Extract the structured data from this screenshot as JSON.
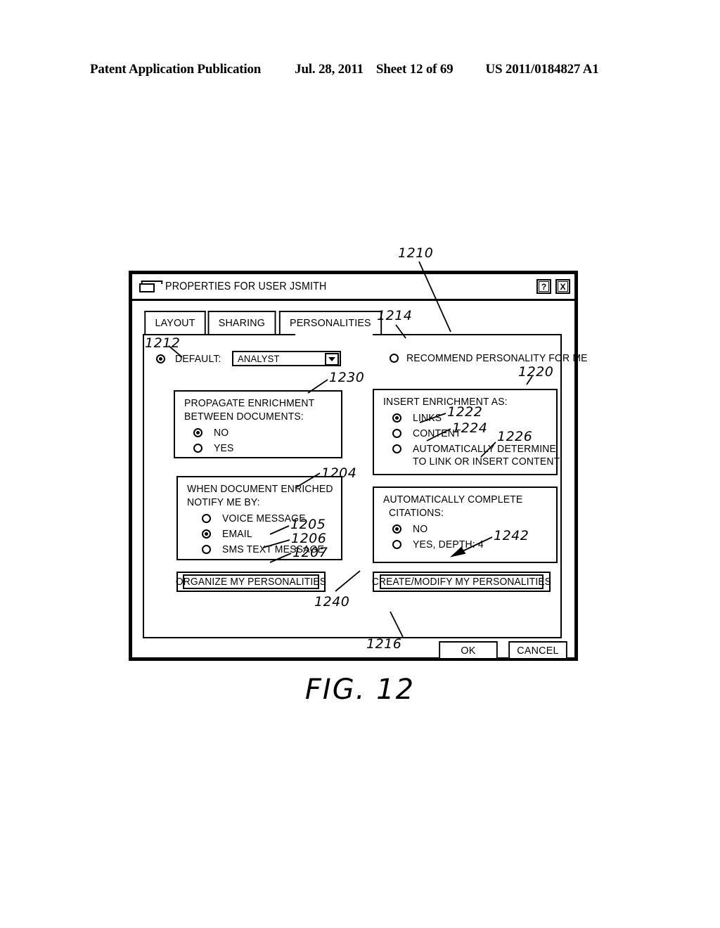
{
  "page_header": {
    "publication": "Patent Application Publication",
    "date": "Jul. 28, 2011",
    "sheet": "Sheet 12 of 69",
    "number": "US 2011/0184827 A1"
  },
  "figure": {
    "caption": "FIG. 12"
  },
  "dialog": {
    "title": "PROPERTIES FOR USER JSMITH",
    "folder_icon": "folder-icon",
    "titlebar_buttons": [
      {
        "name": "help-button",
        "label": "?"
      },
      {
        "name": "close-button",
        "label": "X"
      }
    ],
    "tabs": [
      {
        "label": "LAYOUT",
        "active": false
      },
      {
        "label": "SHARING",
        "active": false
      },
      {
        "label": "PERSONALITIES",
        "active": true
      }
    ],
    "default_personality": {
      "radio_selected": true,
      "label": "DEFAULT:",
      "combo_value": "ANALYST",
      "combo_arrow_icon": "chevron-down-icon"
    },
    "recommend": {
      "radio_selected": false,
      "label": "RECOMMEND PERSONALITY FOR ME"
    },
    "groups": {
      "propagate": {
        "heading_line1": "PROPAGATE ENRICHMENT",
        "heading_line2": "BETWEEN DOCUMENTS:",
        "options": [
          {
            "label": "NO",
            "selected": true
          },
          {
            "label": "YES",
            "selected": false
          }
        ]
      },
      "insert_enrichment": {
        "heading": "INSERT ENRICHMENT AS:",
        "options": [
          {
            "label": "LINKS",
            "selected": true,
            "wrap": ""
          },
          {
            "label": "CONTENT",
            "selected": false,
            "wrap": ""
          },
          {
            "label": "AUTOMATICALLY DETERMINE",
            "selected": false,
            "wrap": "TO LINK OR INSERT CONTENT"
          }
        ]
      },
      "notify": {
        "heading_line1": "WHEN DOCUMENT ENRICHED",
        "heading_line2": "NOTIFY ME BY:",
        "options": [
          {
            "label": "VOICE MESSAGE",
            "selected": false
          },
          {
            "label": "EMAIL",
            "selected": true
          },
          {
            "label": "SMS TEXT MESSAGE",
            "selected": false
          }
        ]
      },
      "citations": {
        "heading_line1": "AUTOMATICALLY COMPLETE",
        "heading_line2": "CITATIONS:",
        "options": [
          {
            "label": "NO",
            "selected": true
          },
          {
            "label": "YES, DEPTH: 4",
            "selected": false
          }
        ]
      }
    },
    "action_buttons": [
      {
        "name": "organize-my-personalities-button",
        "label": "ORGANIZE MY PERSONALITIES"
      },
      {
        "name": "create-modify-my-personalities-button",
        "label": "CREATE/MODIFY MY PERSONALITIES"
      }
    ],
    "footer_buttons": [
      {
        "name": "ok-button",
        "label": "OK"
      },
      {
        "name": "cancel-button",
        "label": "CANCEL"
      }
    ]
  },
  "reference_numerals": {
    "n1210": "1210",
    "n1212": "1212",
    "n1214": "1214",
    "n1216": "1216",
    "n1220": "1220",
    "n1222": "1222",
    "n1224": "1224",
    "n1226": "1226",
    "n1230": "1230",
    "n1204": "1204",
    "n1205": "1205",
    "n1206": "1206",
    "n1207": "1207",
    "n1240": "1240",
    "n1242": "1242"
  }
}
